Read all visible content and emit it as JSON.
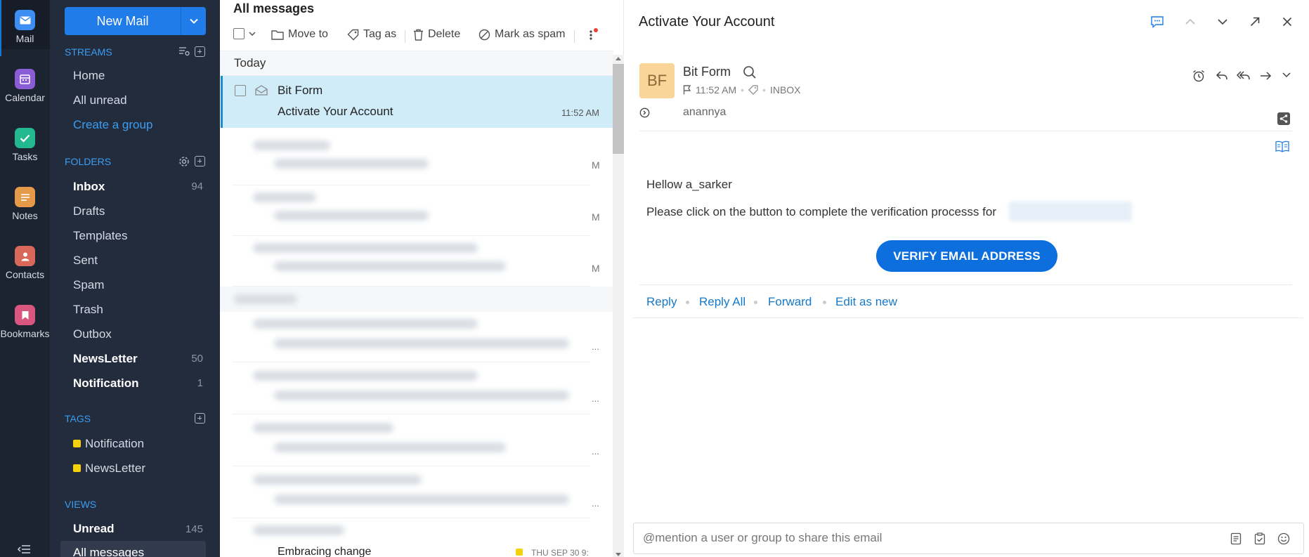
{
  "rail": [
    {
      "label": "Mail",
      "icon": "mail-icon",
      "color": "#3d8ef3"
    },
    {
      "label": "Calendar",
      "icon": "calendar-icon",
      "color": "#8a5cd6"
    },
    {
      "label": "Tasks",
      "icon": "tasks-icon",
      "color": "#23b88f"
    },
    {
      "label": "Notes",
      "icon": "notes-icon",
      "color": "#e59a4a"
    },
    {
      "label": "Contacts",
      "icon": "contacts-icon",
      "color": "#d8685a"
    },
    {
      "label": "Bookmarks",
      "icon": "bookmarks-icon",
      "color": "#d9577f"
    }
  ],
  "compose": {
    "label": "New Mail"
  },
  "streams": {
    "heading": "STREAMS",
    "items": [
      "Home",
      "All unread",
      "Create a group"
    ]
  },
  "folders": {
    "heading": "FOLDERS",
    "items": [
      {
        "label": "Inbox",
        "count": "94"
      },
      {
        "label": "Drafts",
        "count": ""
      },
      {
        "label": "Templates",
        "count": ""
      },
      {
        "label": "Sent",
        "count": ""
      },
      {
        "label": "Spam",
        "count": ""
      },
      {
        "label": "Trash",
        "count": ""
      },
      {
        "label": "Outbox",
        "count": ""
      },
      {
        "label": "NewsLetter",
        "count": "50"
      },
      {
        "label": "Notification",
        "count": "1"
      }
    ]
  },
  "tags": {
    "heading": "TAGS",
    "items": [
      "Notification",
      "NewsLetter"
    ],
    "color": "#f5d10b"
  },
  "views": {
    "heading": "VIEWS",
    "items": [
      {
        "label": "Unread",
        "count": "145"
      },
      {
        "label": "All messages",
        "count": ""
      }
    ]
  },
  "list": {
    "title": "All messages",
    "toolbar": {
      "move": "Move to",
      "tag": "Tag as",
      "delete": "Delete",
      "spam": "Mark as spam"
    },
    "group": "Today",
    "selected": {
      "sender": "Bit Form",
      "subject": "Activate Your Account",
      "time": "11:52 AM"
    },
    "blurred_time_suffix": [
      "M",
      "M",
      "M"
    ],
    "blurred_ellipsis": [
      "...",
      "...",
      "...",
      "...",
      "..."
    ],
    "last": {
      "subject": "Embracing change",
      "time": "THU SEP 30 9:"
    }
  },
  "reader": {
    "subject": "Activate Your Account",
    "avatar": "BF",
    "sender": "Bit Form",
    "time": "11:52 AM",
    "folder": "INBOX",
    "to": "anannya",
    "greeting": "Hellow a_sarker",
    "body": "Please click on the button to complete the verification processs for",
    "button": "VERIFY EMAIL ADDRESS",
    "actions": [
      "Reply",
      "Reply All",
      "Forward",
      "Edit as new"
    ],
    "comment_placeholder": "@mention a user or group to share this email"
  }
}
